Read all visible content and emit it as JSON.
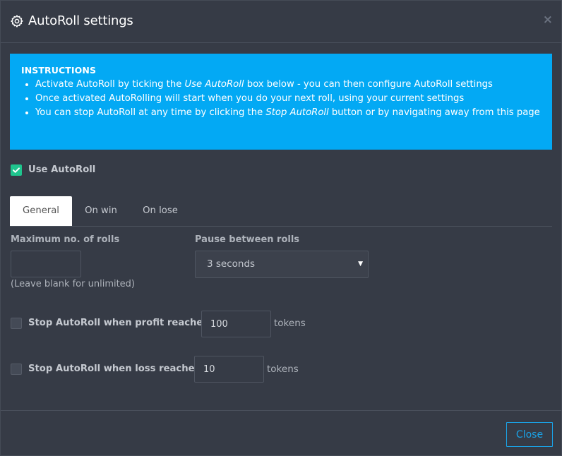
{
  "header": {
    "title": "AutoRoll settings",
    "gear_icon": "gear-icon",
    "close_symbol": "×"
  },
  "instructions": {
    "title": "INSTRUCTIONS",
    "item1_pre": "Activate AutoRoll by ticking the ",
    "item1_em": "Use AutoRoll",
    "item1_post": " box below - you can then configure AutoRoll settings",
    "item2": "Once activated AutoRolling will start when you do your next roll, using your current settings",
    "item3_pre": "You can stop AutoRoll at any time by clicking the ",
    "item3_em": "Stop AutoRoll",
    "item3_post": " button or by navigating away from this page"
  },
  "use_autoroll": {
    "label": "Use AutoRoll",
    "checked": true
  },
  "tabs": [
    {
      "label": "General",
      "active": true
    },
    {
      "label": "On win",
      "active": false
    },
    {
      "label": "On lose",
      "active": false
    }
  ],
  "general": {
    "max_rolls_label": "Maximum no. of rolls",
    "max_rolls_value": "",
    "max_rolls_help": "(Leave blank for unlimited)",
    "pause_label": "Pause between rolls",
    "pause_value": "3 seconds",
    "profit_label": "Stop AutoRoll when profit reaches",
    "profit_value": "100",
    "profit_unit": "tokens",
    "loss_label": "Stop AutoRoll when loss reaches",
    "loss_value": "10",
    "loss_unit": "tokens"
  },
  "footer": {
    "close_label": "Close"
  },
  "colors": {
    "accent": "#03a9f4",
    "check_green": "#1fc58e",
    "background": "#363b46"
  }
}
